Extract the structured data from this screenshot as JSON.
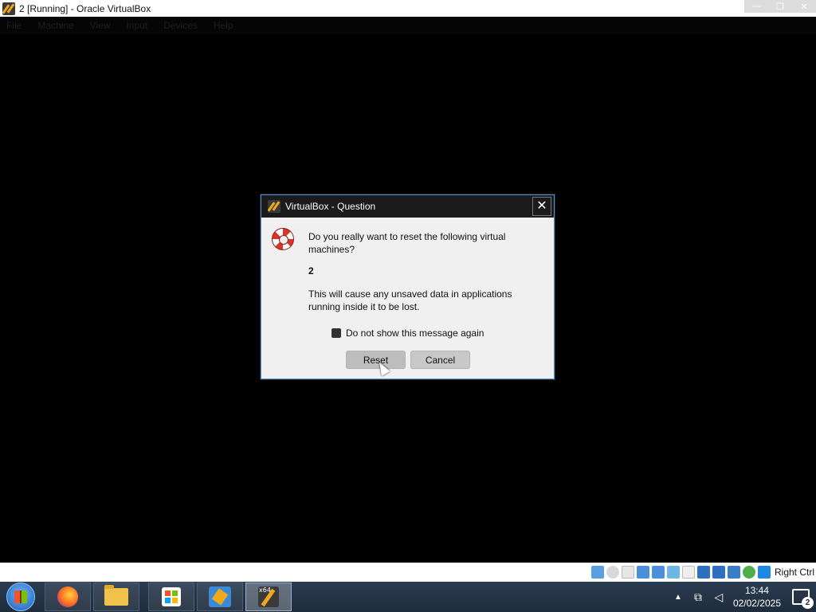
{
  "window": {
    "title": "2 [Running] - Oracle VirtualBox",
    "menu": [
      "File",
      "Machine",
      "View",
      "Input",
      "Devices",
      "Help"
    ],
    "controls": {
      "minimize": "—",
      "maximize": "❐",
      "close": "✕"
    }
  },
  "dialog": {
    "title": "VirtualBox - Question",
    "close_glyph": "✕",
    "question": "Do you really want to reset the following virtual machines?",
    "vm_name": "2",
    "warning": "This will cause any unsaved data in applications running inside it to be lost.",
    "checkbox_label": "Do not show this message again",
    "checkbox_checked": false,
    "reset_label": "Reset",
    "cancel_label": "Cancel",
    "icon": "lifebuoy-icon"
  },
  "statusbar": {
    "host_key": "Right Ctrl",
    "icons": [
      "hard-disk-icon",
      "optical-drive-icon",
      "floppy-icon",
      "audio-icon",
      "network-icon",
      "usb-icon",
      "shared-folders-icon",
      "display-icon",
      "video-capture-icon",
      "cpu-icon",
      "mouse-integration-icon",
      "keyboard-icon"
    ]
  },
  "taskbar": {
    "apps": [
      "firefox-icon",
      "file-explorer-icon",
      "microsoft-store-icon",
      "virtualbox-manager-icon",
      "virtualbox-vm-icon"
    ],
    "x64_label": "x64",
    "tray_arrow": "▲",
    "time": "13:44",
    "date": "02/02/2025",
    "notification_count": "2"
  },
  "colors": {
    "dialog_border": "#4a8fd8",
    "dialog_titlebar": "#1b1b1b",
    "dialog_body": "#f0f0f0",
    "taskbar": "#2c3d52"
  }
}
